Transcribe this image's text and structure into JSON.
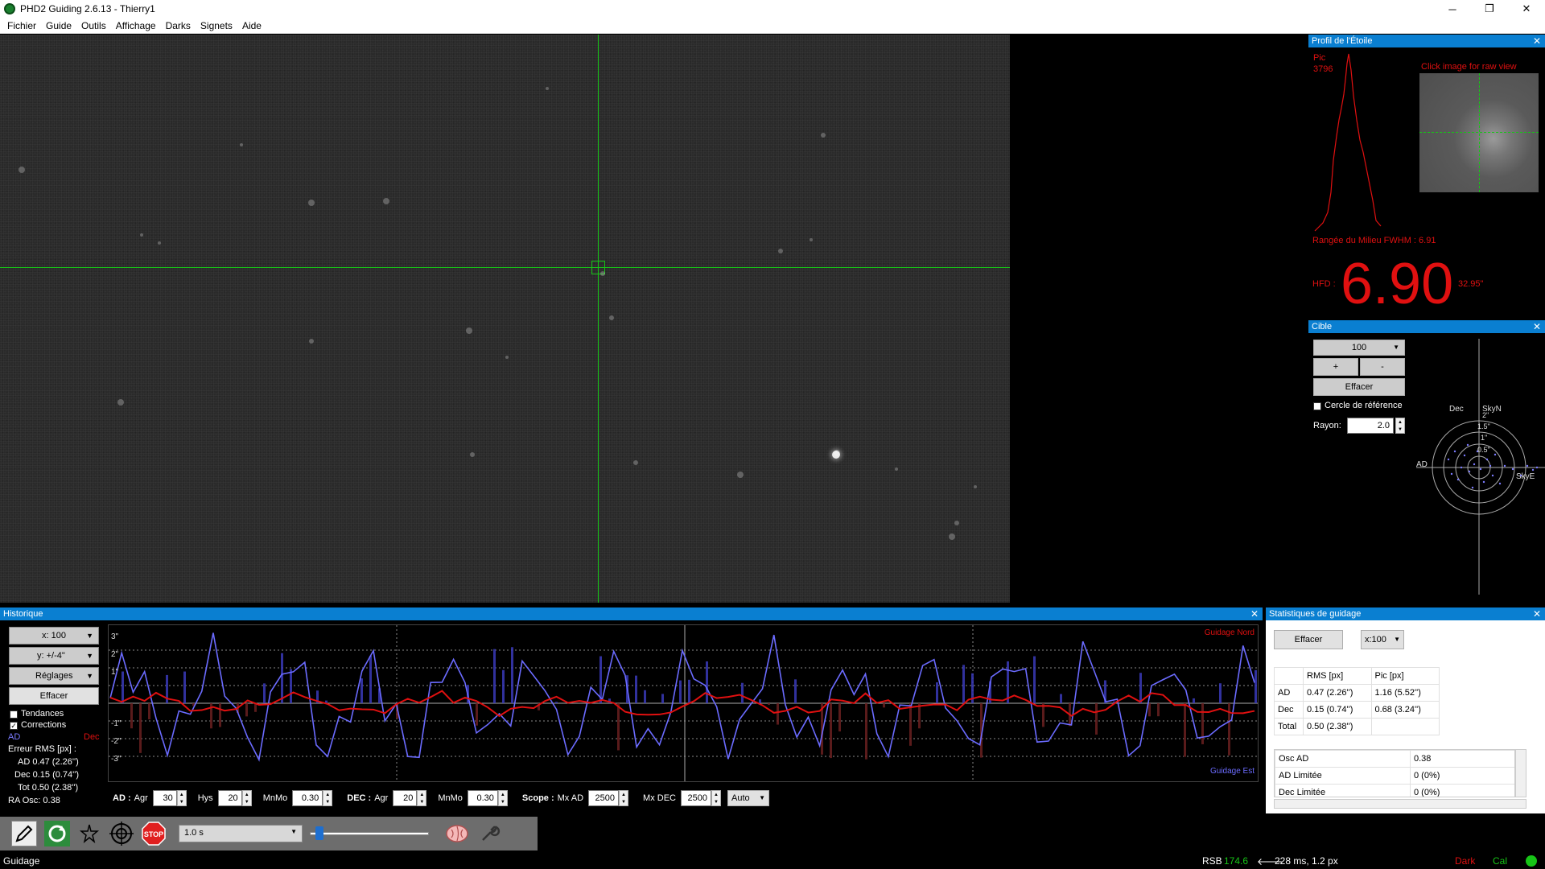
{
  "window": {
    "title": "PHD2 Guiding 2.6.13 - Thierry1",
    "controls": [
      "─",
      "❐",
      "✕"
    ]
  },
  "menu": [
    "Fichier",
    "Guide",
    "Outils",
    "Affichage",
    "Darks",
    "Signets",
    "Aide"
  ],
  "star_profile": {
    "header": "Profil de l'Étoile",
    "peak_label": "Pic",
    "peak_value": "3796",
    "click_hint": "Click image for raw view",
    "fwhm_text": "Rangée du Milieu FWHM : 6.91",
    "hfd_label": "HFD :",
    "hfd_value": "6.90",
    "hfd_arcsec": "32.95\""
  },
  "target": {
    "header": "Cible",
    "zoom_value": "100",
    "plus_label": "+",
    "minus_label": "-",
    "clear_label": "Effacer",
    "ref_circle_label": "Cercle de référence",
    "radius_label": "Rayon:",
    "radius_value": "2.0",
    "dec_label": "Dec",
    "skyn_label": "SkyN",
    "ad_label": "AD",
    "skye_label": "SkyE",
    "ring_labels": [
      "2\"",
      "1.5\"",
      "1\"",
      "0.5\""
    ]
  },
  "history": {
    "header": "Historique",
    "x_scale": "x: 100",
    "y_scale": "y: +/-4\"",
    "settings_label": "Réglages",
    "clear_label": "Effacer",
    "trends_label": "Tendances",
    "corrections_label": "Corrections",
    "ra_legend": "AD",
    "dec_legend": "Dec",
    "rms_title": "Erreur RMS [px] :",
    "rms_ra": "AD  0.47 (2.26'')",
    "rms_dec": "Dec  0.15 (0.74'')",
    "rms_tot": "Tot  0.50 (2.38'')",
    "ra_osc": "RA Osc: 0.38",
    "guide_north": "Guidage Nord",
    "guide_east": "Guidage Est",
    "y_ticks": [
      "3\"",
      "2\"",
      "1\"",
      "-1\"",
      "-2\"",
      "-3\""
    ],
    "controls": {
      "ra_label": "AD :",
      "agr_label": "Agr",
      "ra_agr": "30",
      "hys_label": "Hys",
      "hys": "20",
      "mnmo_label": "MnMo",
      "ra_mnmo": "0.30",
      "dec_label": "DEC :",
      "dec_agr": "20",
      "dec_mnmo": "0.30",
      "scope_label": "Scope :",
      "mx_ad_label": "Mx AD",
      "mx_ad": "2500",
      "mx_dec_label": "Mx DEC",
      "mx_dec": "2500",
      "mode": "Auto"
    }
  },
  "stats": {
    "header": "Statistiques de guidage",
    "clear_label": "Effacer",
    "x_scale": "x:100",
    "col_rms": "RMS [px]",
    "col_peak": "Pic [px]",
    "rows": [
      {
        "name": "AD",
        "rms": "0.47 (2.26'')",
        "peak": "1.16 (5.52'')"
      },
      {
        "name": "Dec",
        "rms": "0.15 (0.74'')",
        "peak": "0.68 (3.24'')"
      },
      {
        "name": "Total",
        "rms": "0.50 (2.38'')",
        "peak": ""
      }
    ],
    "info_rows": [
      {
        "name": "Osc AD",
        "value": "0.38"
      },
      {
        "name": "AD Limitée",
        "value": "0 (0%)"
      },
      {
        "name": "Dec Limitée",
        "value": "0 (0%)"
      }
    ]
  },
  "toolbar": {
    "exposure": "1.0 s"
  },
  "status": {
    "state": "Guidage",
    "snr_label": "RSB",
    "snr_value": "174.6",
    "guide_info": "228 ms, 1.2 px",
    "dark": "Dark",
    "cal": "Cal"
  },
  "colors": {
    "accent": "#0a7fd1",
    "ra": "#6b6bff",
    "dec": "#e01010",
    "crosshair": "#17c417"
  }
}
